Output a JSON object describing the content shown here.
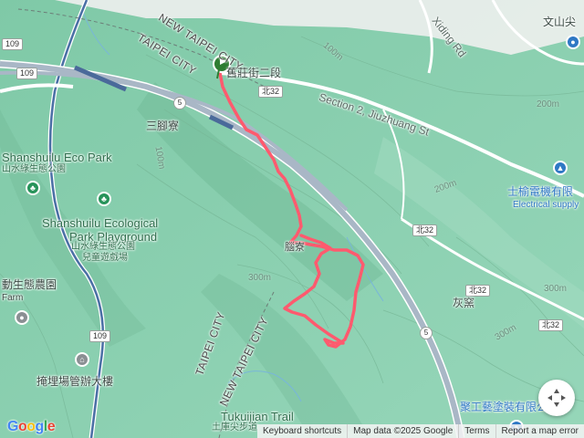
{
  "map": {
    "labels": {
      "new_taipei_city_top": "NEW TAIPEI CITY",
      "taipei_city_top": "TAIPEI CITY",
      "jiuzhuang_zh": "舊莊街二段",
      "jiuzhuang_en": "Section 2, Jiuzhuang St",
      "xiding_rd": "Xiding Rd",
      "sanying_liao": "三腳寮",
      "shanshuilu_eco_park": "Shanshuilu Eco Park",
      "shanshuilu_eco_park_zh": "山水綠生態公園",
      "shanshuilu_playground_1": "Shanshuilu Ecological",
      "shanshuilu_playground_2": "Park Playground",
      "shanshuilu_playground_zh_1": "山水綠生態公園",
      "shanshuilu_playground_zh_2": "兒童遊戲場",
      "eco_farm_zh": "動生態農園",
      "eco_farm_en": "Farm",
      "landfill_office": "掩埋場管辦大樓",
      "taipei_city_mid": "TAIPEI CITY",
      "new_taipei_city_mid": "NEW TAIPEI CITY",
      "tukuijian_trail": "Tukuijian Trail",
      "tukuijian_zh": "土庫尖步道",
      "wenshan_zh": "文山尖",
      "electrical_zh": "士榆電機有限",
      "electrical_en": "Electrical supply",
      "huiyao": "灰窯",
      "decor_company": "聚工藝塗裝有限公",
      "trail_mark": "腦寮"
    },
    "roads": {
      "r109_a": "109",
      "r109_b": "109",
      "r109_c": "109",
      "bei32_a": "北32",
      "bei32_b": "北32",
      "bei32_c": "北32",
      "bei32_d": "北32",
      "nat5_a": "5",
      "nat5_b": "5"
    },
    "contours": {
      "c100a": "100m",
      "c100b": "100m",
      "c200a": "200m",
      "c200b": "200m",
      "c300a": "300m",
      "c300b": "300m",
      "c300c": "300m"
    },
    "colors": {
      "terrain": "#8fd1b4",
      "track": "#ff5a6e",
      "highway": "#a9b7c6",
      "start_marker": "#2e7d32"
    }
  },
  "footer": {
    "logo": "Google",
    "shortcuts": "Keyboard shortcuts",
    "map_data": "Map data ©2025 Google",
    "terms": "Terms",
    "report": "Report a map error"
  },
  "controls": {
    "compass_icon": "compass-rose-icon"
  }
}
